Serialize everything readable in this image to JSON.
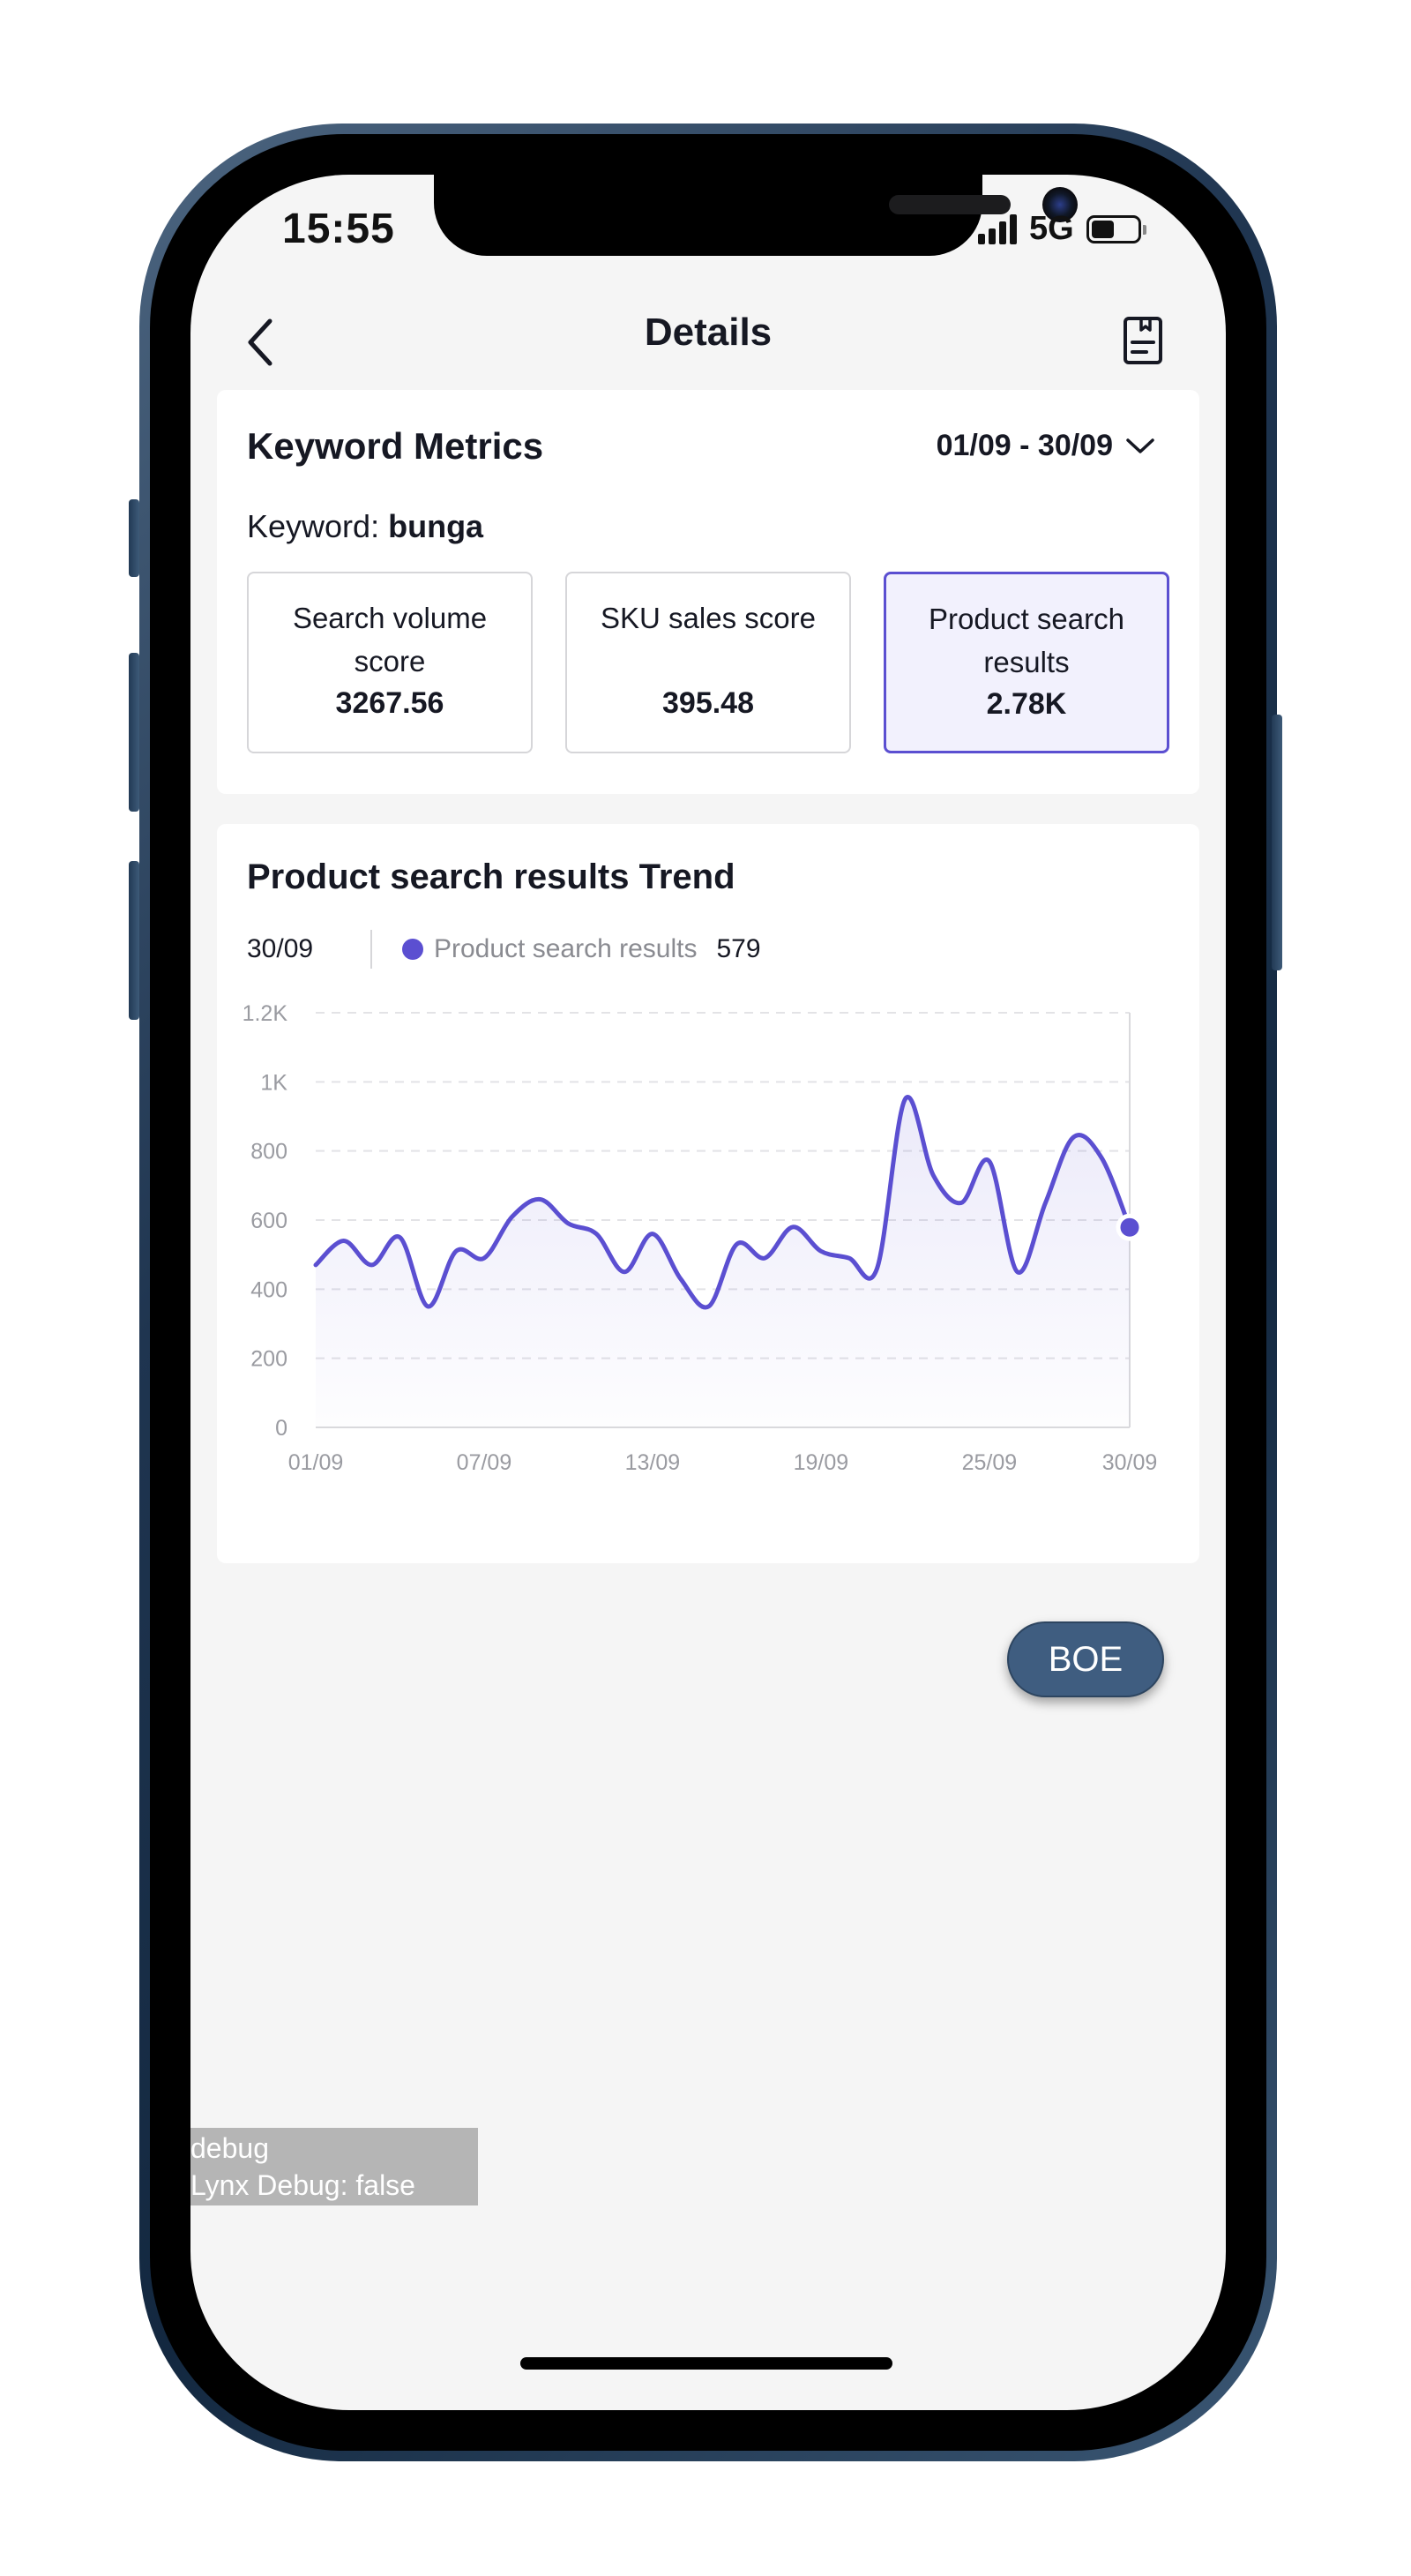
{
  "status_bar": {
    "time": "15:55",
    "network": "5G",
    "battery_level": 0.5
  },
  "nav": {
    "title": "Details",
    "back_icon": "chevron-left-icon",
    "right_icon": "document-icon"
  },
  "keyword_metrics": {
    "title": "Keyword Metrics",
    "date_range": "01/09 - 30/09",
    "keyword_label": "Keyword:",
    "keyword_value": "bunga",
    "metrics": [
      {
        "label": "Search volume score",
        "value": "3267.56",
        "selected": false
      },
      {
        "label": "SKU sales score",
        "value": "395.48",
        "selected": false
      },
      {
        "label": "Product search results",
        "value": "2.78K",
        "selected": true
      }
    ]
  },
  "trend": {
    "title": "Product search results Trend",
    "selected_date": "30/09",
    "series_name": "Product search results",
    "selected_value": "579"
  },
  "chart_data": {
    "type": "area",
    "x": [
      "01/09",
      "02/09",
      "03/09",
      "04/09",
      "05/09",
      "06/09",
      "07/09",
      "08/09",
      "09/09",
      "10/09",
      "11/09",
      "12/09",
      "13/09",
      "14/09",
      "15/09",
      "16/09",
      "17/09",
      "18/09",
      "19/09",
      "20/09",
      "21/09",
      "22/09",
      "23/09",
      "24/09",
      "25/09",
      "26/09",
      "27/09",
      "28/09",
      "29/09",
      "30/09"
    ],
    "series": [
      {
        "name": "Product search results",
        "color": "#5b4fd1",
        "values": [
          470,
          540,
          470,
          550,
          350,
          510,
          490,
          610,
          660,
          590,
          560,
          450,
          560,
          430,
          350,
          530,
          490,
          580,
          510,
          490,
          460,
          950,
          730,
          650,
          770,
          450,
          650,
          840,
          780,
          579
        ]
      }
    ],
    "x_tick_labels": [
      "01/09",
      "07/09",
      "13/09",
      "19/09",
      "25/09",
      "30/09"
    ],
    "y_tick_labels": [
      "0",
      "200",
      "400",
      "600",
      "800",
      "1K",
      "1.2K"
    ],
    "y_ticks": [
      0,
      200,
      400,
      600,
      800,
      1000,
      1200
    ],
    "ylim": [
      0,
      1200
    ],
    "grid": true,
    "highlighted_point": "30/09"
  },
  "floating": {
    "boe_label": "BOE"
  },
  "debug": {
    "line1": "debug",
    "line2": "Lynx Debug: false"
  }
}
